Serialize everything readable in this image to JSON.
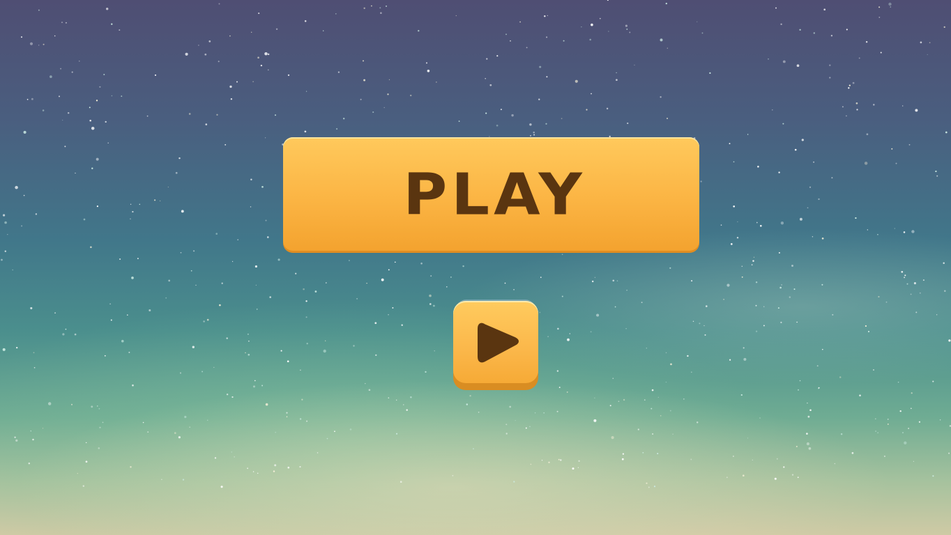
{
  "scene": {
    "background": "starry-night-sky",
    "colors": {
      "sky_top": "#4f4e73",
      "sky_mid": "#41778a",
      "sky_bottom": "#cfcaa5",
      "button_face": "#fbb443",
      "button_text": "#5a3510"
    }
  },
  "menu": {
    "play_label": "PLAY",
    "play_icon": "play-triangle-icon"
  }
}
